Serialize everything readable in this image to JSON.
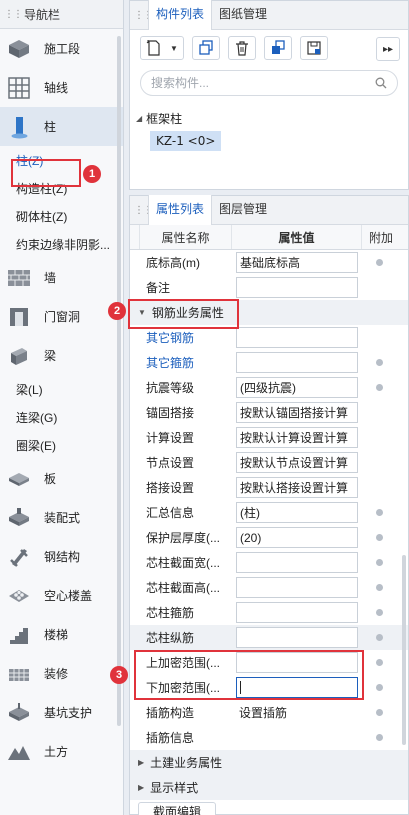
{
  "nav": {
    "title": "导航栏",
    "items_top": [
      {
        "label": "施工段",
        "icon": "construction-segment-icon"
      },
      {
        "label": "轴线",
        "icon": "grid-axis-icon"
      },
      {
        "label": "柱",
        "icon": "column-icon",
        "active": true
      }
    ],
    "column_sub": [
      "柱(Z)",
      "构造柱(Z)",
      "砌体柱(Z)",
      "约束边缘非阴影..."
    ],
    "items_mid": [
      {
        "label": "墙",
        "icon": "wall-icon"
      },
      {
        "label": "门窗洞",
        "icon": "door-window-icon"
      },
      {
        "label": "梁",
        "icon": "beam-icon"
      }
    ],
    "beam_sub": [
      "梁(L)",
      "连梁(G)",
      "圈梁(E)"
    ],
    "items_bottom": [
      {
        "label": "板",
        "icon": "slab-icon"
      },
      {
        "label": "装配式",
        "icon": "prefab-icon"
      },
      {
        "label": "钢结构",
        "icon": "steel-structure-icon"
      },
      {
        "label": "空心楼盖",
        "icon": "hollow-floor-icon"
      },
      {
        "label": "楼梯",
        "icon": "stairs-icon"
      },
      {
        "label": "装修",
        "icon": "decoration-icon"
      },
      {
        "label": "基坑支护",
        "icon": "pit-support-icon"
      },
      {
        "label": "土方",
        "icon": "earthwork-icon"
      }
    ]
  },
  "component_panel": {
    "tabs": [
      "构件列表",
      "图纸管理"
    ],
    "search_placeholder": "搜索构件...",
    "tree_root": "框架柱",
    "tree_child": "KZ-1 <0>"
  },
  "property_panel": {
    "tabs": [
      "属性列表",
      "图层管理"
    ],
    "headers": {
      "name": "属性名称",
      "value": "属性值",
      "add": "附加"
    },
    "rows": [
      {
        "name": "底标高(m)",
        "value": "基础底标高",
        "dot": true
      },
      {
        "name": "备注",
        "value": "",
        "dot": false
      },
      {
        "group": "钢筋业务属性"
      },
      {
        "name": "其它钢筋",
        "value": "",
        "dot": false,
        "blue": true
      },
      {
        "name": "其它箍筋",
        "value": "",
        "dot": true,
        "blue": true
      },
      {
        "name": "抗震等级",
        "value": "(四级抗震)",
        "dot": true
      },
      {
        "name": "锚固搭接",
        "value": "按默认锚固搭接计算",
        "dot": false
      },
      {
        "name": "计算设置",
        "value": "按默认计算设置计算",
        "dot": false
      },
      {
        "name": "节点设置",
        "value": "按默认节点设置计算",
        "dot": false
      },
      {
        "name": "搭接设置",
        "value": "按默认搭接设置计算",
        "dot": false
      },
      {
        "name": "汇总信息",
        "value": "(柱)",
        "dot": true
      },
      {
        "name": "保护层厚度(...",
        "value": "(20)",
        "dot": true
      },
      {
        "name": "芯柱截面宽(...",
        "value": "",
        "dot": true
      },
      {
        "name": "芯柱截面高(...",
        "value": "",
        "dot": true
      },
      {
        "name": "芯柱箍筋",
        "value": "",
        "dot": true
      },
      {
        "name": "芯柱纵筋",
        "value": "",
        "dot": true,
        "grey": true
      },
      {
        "name": "上加密范围(...",
        "value": "",
        "dot": true
      },
      {
        "name": "下加密范围(...",
        "value": "",
        "dot": true,
        "focus": true
      },
      {
        "name": "插筋构造",
        "value": "设置插筋",
        "dot": true,
        "nobox": true
      },
      {
        "name": "插筋信息",
        "value": "",
        "dot": true,
        "nobox": true
      }
    ],
    "groups_collapsed": [
      "土建业务属性",
      "显示样式"
    ],
    "bottom_button": "截面编辑"
  },
  "annotations": [
    "1",
    "2",
    "3"
  ],
  "colors": {
    "accent": "#1c5fbd",
    "annotation": "#e0333b",
    "selected_bg": "#cfe0f5"
  }
}
